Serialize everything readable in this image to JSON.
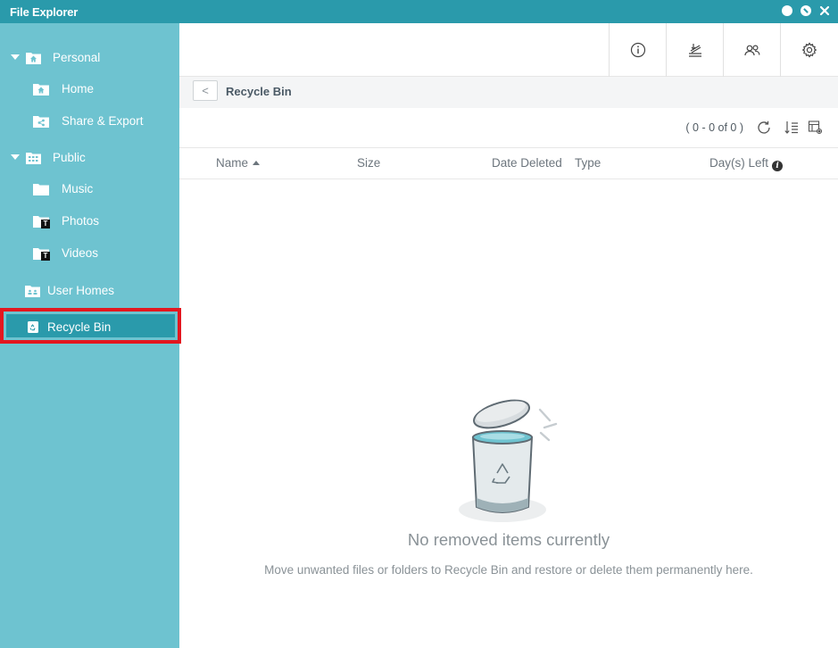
{
  "window": {
    "title": "File Explorer"
  },
  "sidebar": {
    "personal": {
      "label": "Personal",
      "children": [
        {
          "label": "Home"
        },
        {
          "label": "Share & Export"
        }
      ]
    },
    "public": {
      "label": "Public",
      "children": [
        {
          "label": "Music"
        },
        {
          "label": "Photos"
        },
        {
          "label": "Videos"
        }
      ]
    },
    "user_homes": {
      "label": "User Homes"
    },
    "recycle_bin": {
      "label": "Recycle Bin"
    },
    "badge_text": "T"
  },
  "pathbar": {
    "back_glyph": "<",
    "title": "Recycle Bin"
  },
  "toolbar": {
    "count_text": "( 0 - 0 of 0 )"
  },
  "table": {
    "columns": {
      "name": "Name",
      "size": "Size",
      "date_deleted": "Date Deleted",
      "type": "Type",
      "days_left": "Day(s) Left"
    },
    "info_glyph": "i"
  },
  "empty_state": {
    "title": "No removed items currently",
    "subtitle": "Move unwanted files or folders to Recycle Bin and restore or delete them permanently here."
  },
  "colors": {
    "accent": "#2a9aab",
    "sidebar_bg": "#6ec3d0",
    "highlight_border": "#e3171f"
  }
}
